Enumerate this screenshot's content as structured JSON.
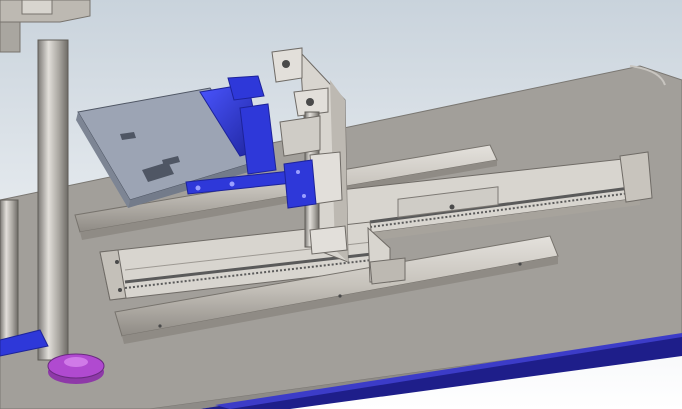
{
  "viewport": {
    "background_top": "#c9d3dc",
    "background_bottom": "#ffffff"
  },
  "colors": {
    "table_top": "#a29f9a",
    "table_edge": "#8e8b87",
    "table_trim": "#1e1e8a",
    "table_trim_highlight": "#3c3cc8",
    "frame_light": "#d8d5cf",
    "frame_mid": "#bdb9b2",
    "frame_dark": "#8f8b85",
    "blue_part": "#2e38d9",
    "blue_part_dark": "#1d239a",
    "magenta_foot": "#b04ad0",
    "gripper_plate": "#9ca4b4",
    "screw": "#4a4a4a",
    "rail_belt": "#5a5a5a"
  },
  "objects": [
    {
      "name": "worktable",
      "icon": "table-shape"
    },
    {
      "name": "left-column",
      "icon": "cylinder-column"
    },
    {
      "name": "leveling-foot",
      "icon": "magenta-foot"
    },
    {
      "name": "front-linear-actuator",
      "icon": "linear-axis"
    },
    {
      "name": "rear-linear-actuator",
      "icon": "linear-axis"
    },
    {
      "name": "vertical-carriage",
      "icon": "vertical-axis"
    },
    {
      "name": "gripper-plate",
      "icon": "tray-plate"
    },
    {
      "name": "blue-clamp-assembly",
      "icon": "blue-clamp"
    }
  ]
}
